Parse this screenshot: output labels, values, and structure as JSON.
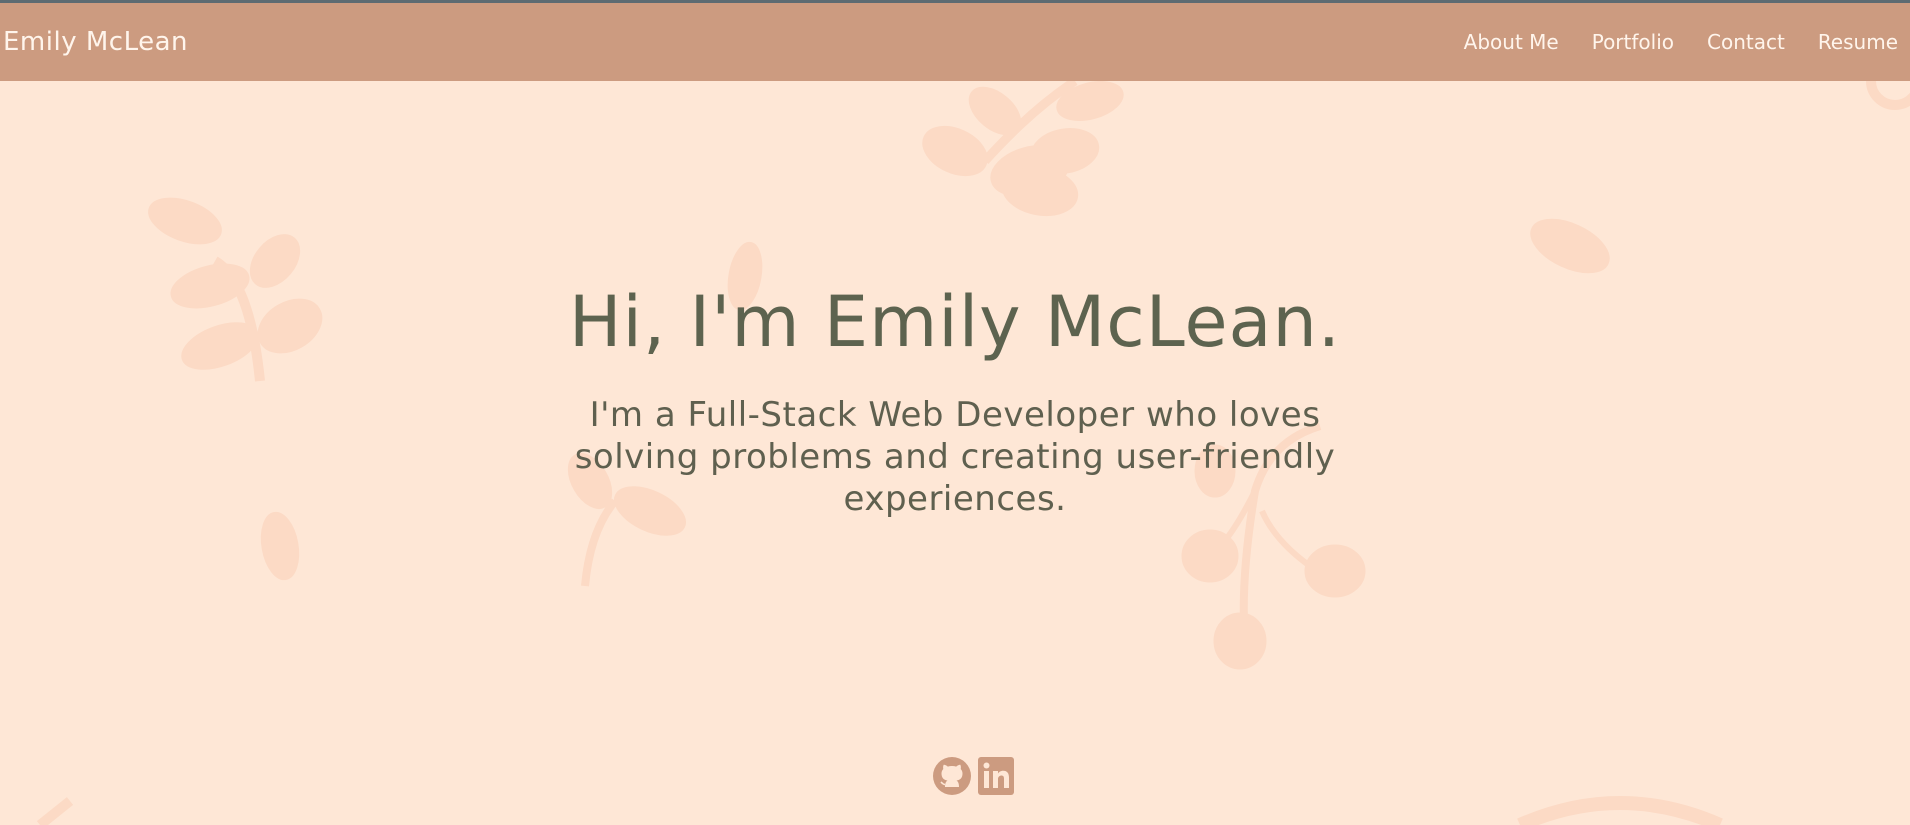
{
  "navbar": {
    "brand": "Emily McLean",
    "links": [
      {
        "label": "About Me"
      },
      {
        "label": "Portfolio"
      },
      {
        "label": "Contact"
      },
      {
        "label": "Resume"
      }
    ]
  },
  "hero": {
    "heading": "Hi, I'm Emily McLean.",
    "tagline": "I'm a Full-Stack Web Developer who loves solving problems and creating user-friendly experiences."
  },
  "socials": [
    {
      "icon": "github-icon"
    },
    {
      "icon": "linkedin-icon"
    }
  ],
  "colors": {
    "background": "#fee7d6",
    "navbar": "#cc9b80",
    "text": "#5d634f",
    "leaf": "#fcd8c2"
  }
}
